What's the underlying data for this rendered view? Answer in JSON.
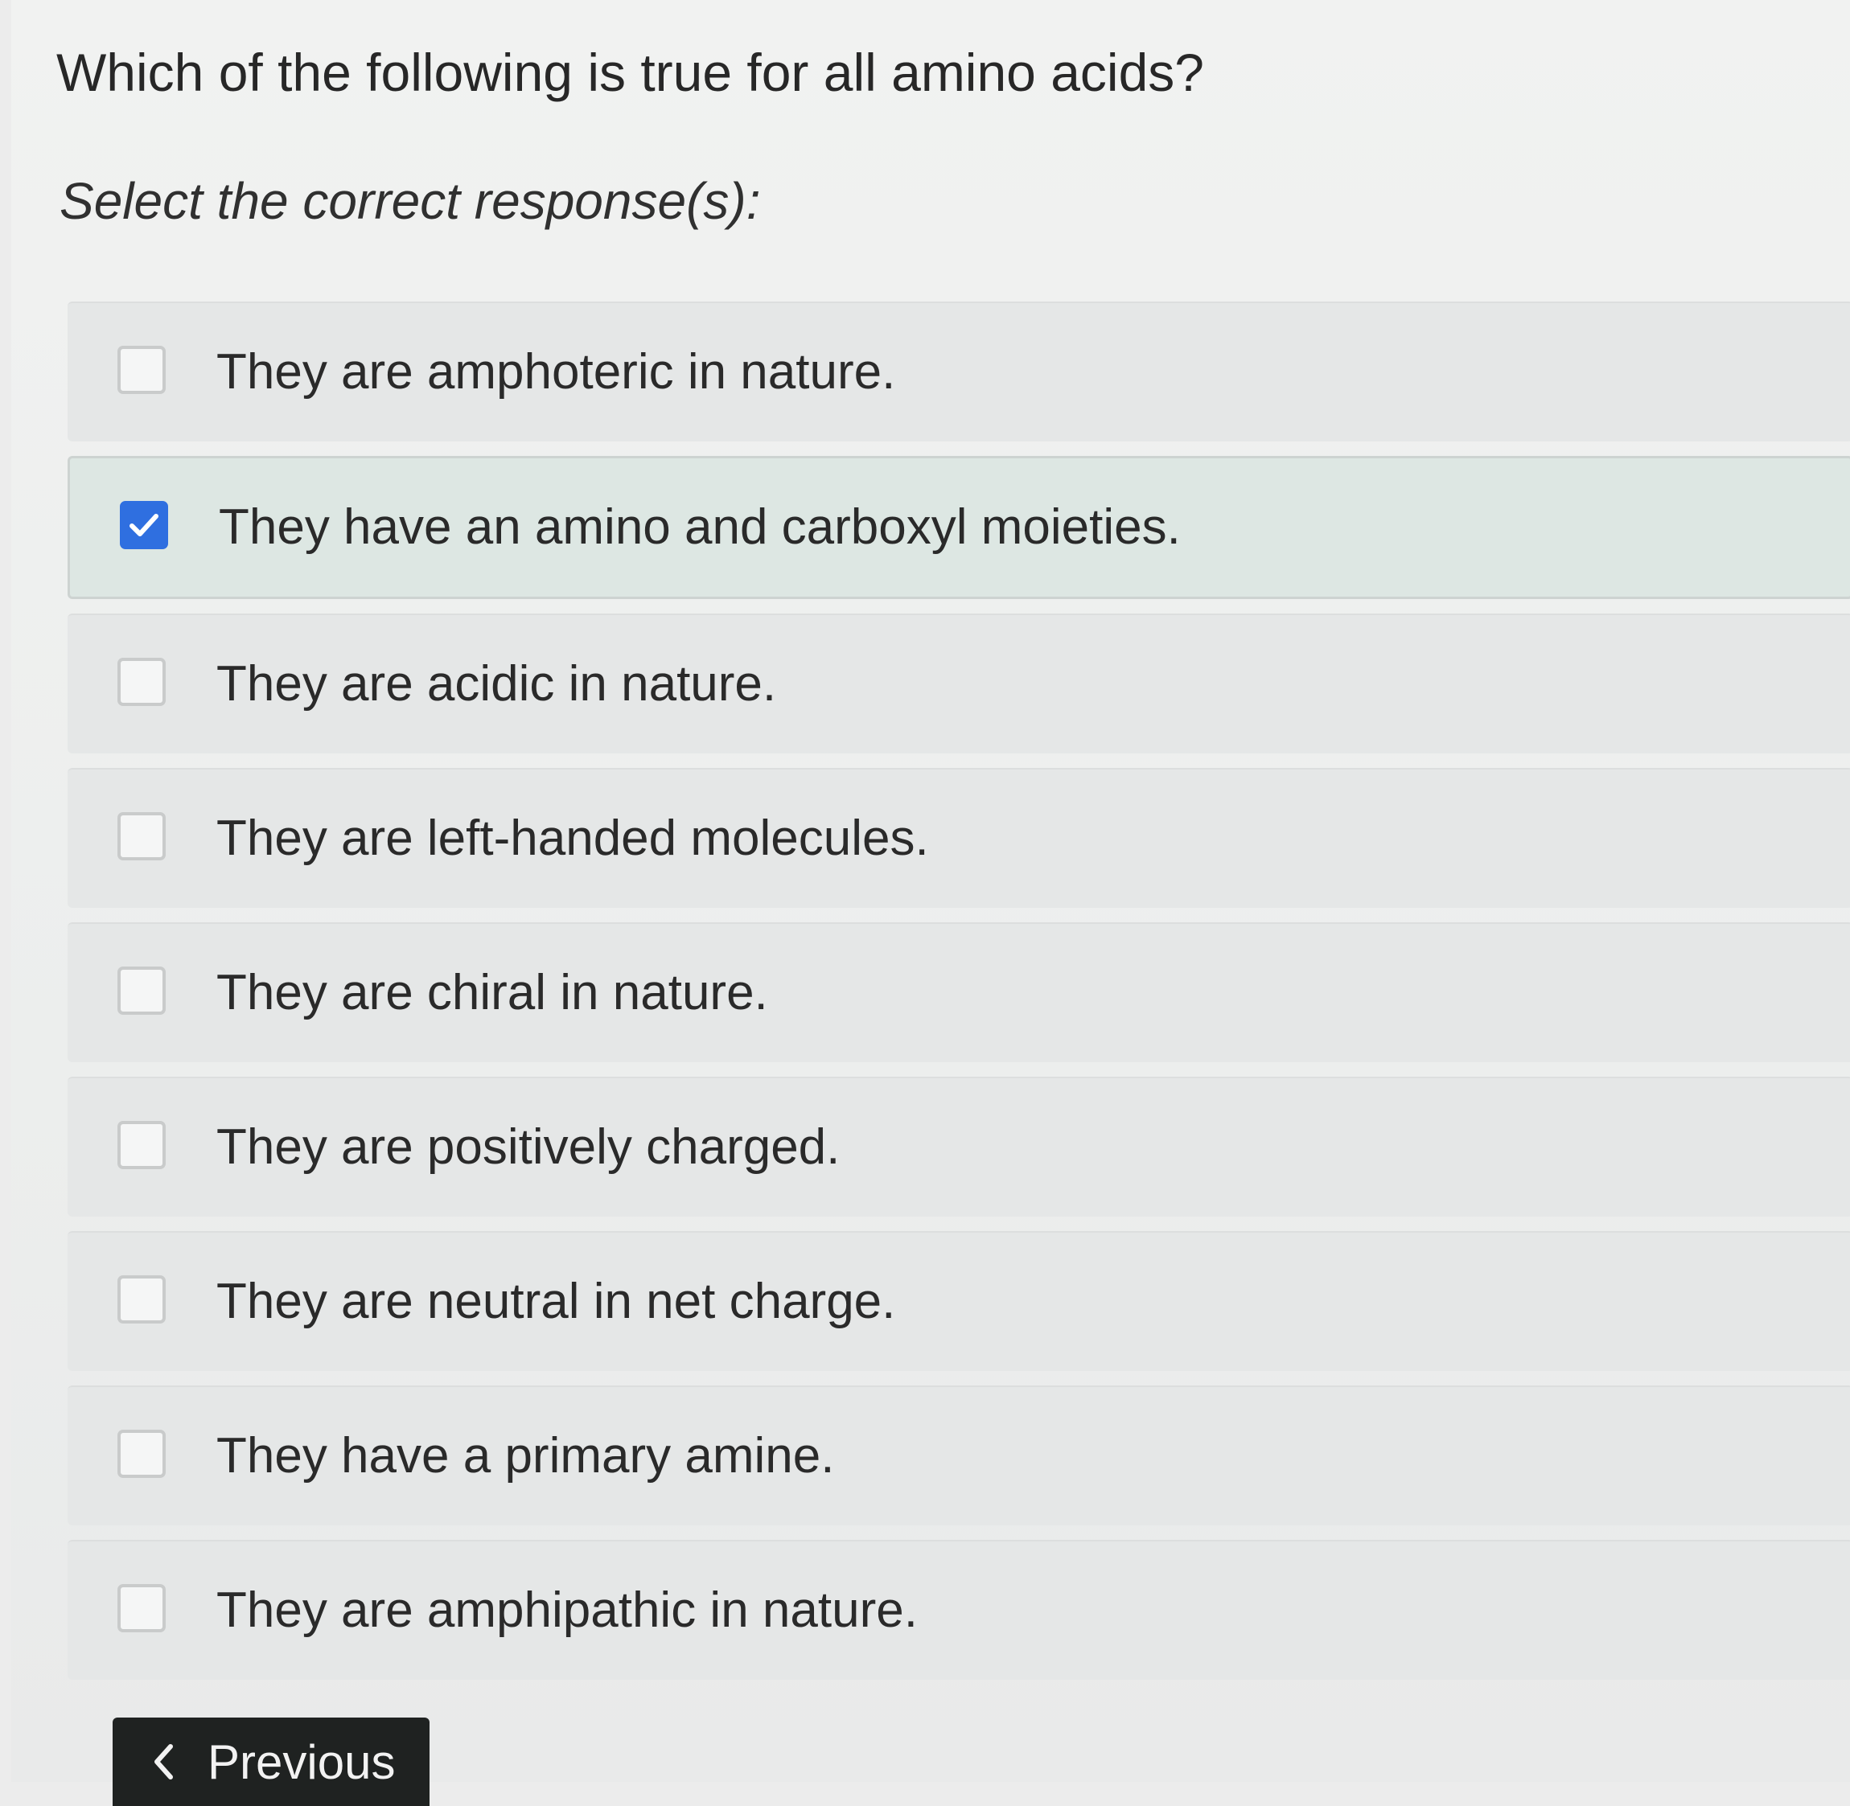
{
  "question": {
    "text": "Which of the following is true for all amino acids?",
    "instruction": "Select the correct response(s):"
  },
  "options": [
    {
      "label": "They are amphoteric in nature.",
      "checked": false
    },
    {
      "label": "They have an amino and carboxyl moieties.",
      "checked": true
    },
    {
      "label": "They are acidic in nature.",
      "checked": false
    },
    {
      "label": "They are left-handed molecules.",
      "checked": false
    },
    {
      "label": "They are chiral in nature.",
      "checked": false
    },
    {
      "label": "They are positively charged.",
      "checked": false
    },
    {
      "label": "They are neutral in net charge.",
      "checked": false
    },
    {
      "label": "They have a primary amine.",
      "checked": false
    },
    {
      "label": "They are amphipathic in nature.",
      "checked": false
    }
  ],
  "navigation": {
    "previous_label": "Previous",
    "previous_icon": "chevron-left-icon"
  },
  "colors": {
    "checkbox_checked": "#2f6fe0",
    "button_background": "#1f2221"
  }
}
